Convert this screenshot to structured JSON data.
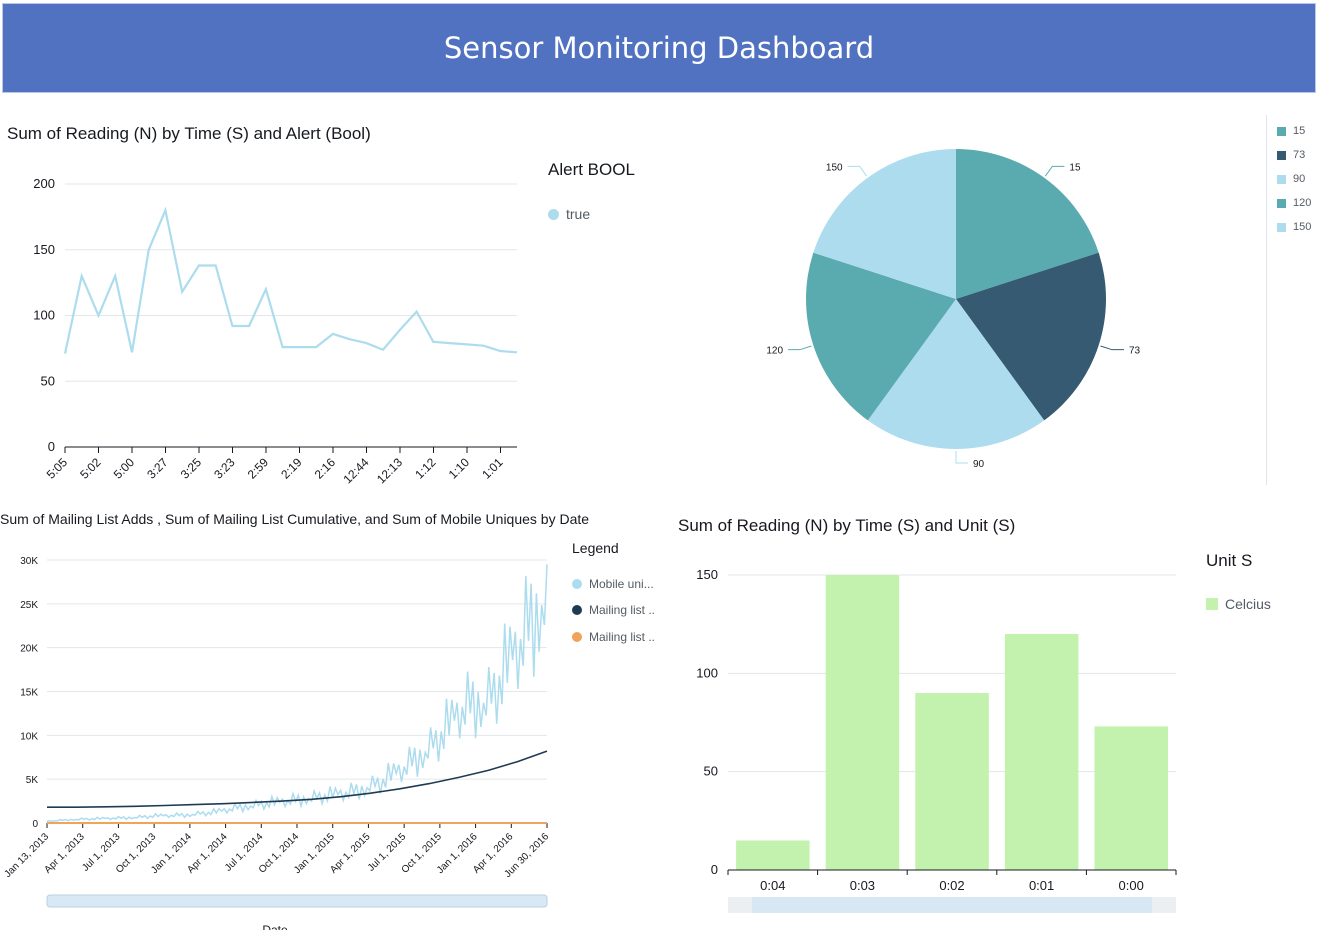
{
  "header": {
    "title": "Sensor Monitoring Dashboard"
  },
  "colors": {
    "header_bg": "#5172c1",
    "light_blue": "#acdcee",
    "teal": "#5aabaf",
    "navy": "#355a72",
    "orange": "#f0a45a",
    "green": "#c2f2ae"
  },
  "panels": {
    "line_alert": {
      "title": "Sum of Reading (N) by Time (S) and Alert (Bool)",
      "legend_title": "Alert BOOL",
      "legend_items": [
        {
          "label": "true",
          "color": "#acdcee"
        }
      ]
    },
    "pie": {
      "legend_items": [
        {
          "label": "15",
          "color": "#5aabaf"
        },
        {
          "label": "73",
          "color": "#355a72"
        },
        {
          "label": "90",
          "color": "#acdcee"
        },
        {
          "label": "120",
          "color": "#5aabaf"
        },
        {
          "label": "150",
          "color": "#acdcee"
        }
      ]
    },
    "mailing": {
      "title": "Sum of Mailing List Adds , Sum of Mailing List Cumulative, and Sum of Mobile Uniques by Date",
      "legend_title": "Legend",
      "legend_items": [
        {
          "label": "Mobile uni...",
          "color": "#acdcee"
        },
        {
          "label": "Mailing list ..",
          "color": "#1f3b53"
        },
        {
          "label": "Mailing list ..",
          "color": "#f0a45a"
        }
      ],
      "x_axis_label": "Date"
    },
    "bar_unit": {
      "title": "Sum of Reading (N) by Time (S) and Unit (S)",
      "legend_title": "Unit S",
      "legend_items": [
        {
          "label": "Celcius",
          "color": "#c2f2ae"
        }
      ]
    }
  },
  "chart_data": [
    {
      "type": "line",
      "title": "Sum of Reading (N) by Time (S) and Alert (Bool)",
      "ylim": [
        0,
        200
      ],
      "yticks": [
        0,
        50,
        100,
        150,
        200
      ],
      "xtick_labels": [
        "5:05",
        "5:02",
        "5:00",
        "3:27",
        "3:25",
        "3:23",
        "2:59",
        "2:19",
        "2:16",
        "12:44",
        "12:13",
        "1:12",
        "1:10",
        "1:01"
      ],
      "series": [
        {
          "name": "true",
          "color": "#acdcee",
          "values": [
            71,
            130,
            100,
            130,
            72,
            150,
            180,
            118,
            138,
            138,
            92,
            92,
            120,
            76,
            76,
            76,
            86,
            82,
            79,
            74,
            89,
            103,
            80,
            79,
            78,
            77,
            73,
            72
          ]
        }
      ]
    },
    {
      "type": "pie",
      "labels": [
        "15",
        "73",
        "90",
        "120",
        "150"
      ],
      "values": [
        1,
        1,
        1,
        1,
        1
      ],
      "colors": [
        "#5aabaf",
        "#355a72",
        "#acdcee",
        "#5aabaf",
        "#acdcee"
      ]
    },
    {
      "type": "line",
      "title": "Sum of Mailing List Adds , Sum of Mailing List Cumulative, and Sum of Mobile Uniques by Date",
      "ylim": [
        0,
        30000
      ],
      "ytick_labels": [
        "0",
        "5K",
        "10K",
        "15K",
        "20K",
        "25K",
        "30K"
      ],
      "xtick_labels": [
        "Jan 13, 2013",
        "Apr 1, 2013",
        "Jul 1, 2013",
        "Oct 1, 2013",
        "Jan 1, 2014",
        "Apr 1, 2014",
        "Jul 1, 2014",
        "Oct 1, 2014",
        "Jan 1, 2015",
        "Apr 1, 2015",
        "Jul 1, 2015",
        "Oct 1, 2015",
        "Jan 1, 2016",
        "Apr 1, 2016",
        "Jun 30, 2016"
      ],
      "series": [
        {
          "name": "Mobile uni...",
          "color": "#acdcee",
          "values": [
            200,
            400,
            500,
            600,
            800,
            900,
            1200,
            1800,
            2200,
            2600,
            3000,
            3500,
            4500,
            6500,
            9000,
            13000,
            14000,
            20000,
            26000
          ]
        },
        {
          "name": "Mailing list ..",
          "color": "#1f3b53",
          "values": [
            1800,
            1800,
            1850,
            1900,
            2000,
            2100,
            2200,
            2350,
            2500,
            2700,
            3000,
            3400,
            3900,
            4500,
            5200,
            6000,
            7000,
            8200
          ]
        },
        {
          "name": "Mailing list ..",
          "color": "#f0a45a",
          "values": [
            0,
            0,
            0,
            0,
            0,
            0,
            0,
            0,
            0,
            0,
            0,
            0,
            0,
            0,
            0,
            0,
            0,
            0
          ]
        }
      ]
    },
    {
      "type": "bar",
      "title": "Sum of Reading (N) by Time (S) and Unit (S)",
      "categories": [
        "0:04",
        "0:03",
        "0:02",
        "0:01",
        "0:00"
      ],
      "values": [
        15,
        150,
        90,
        120,
        73
      ],
      "ylim": [
        0,
        150
      ],
      "yticks": [
        0,
        50,
        100,
        150
      ],
      "series": [
        {
          "name": "Celcius",
          "color": "#c2f2ae",
          "values": [
            15,
            150,
            90,
            120,
            73
          ]
        }
      ]
    }
  ]
}
